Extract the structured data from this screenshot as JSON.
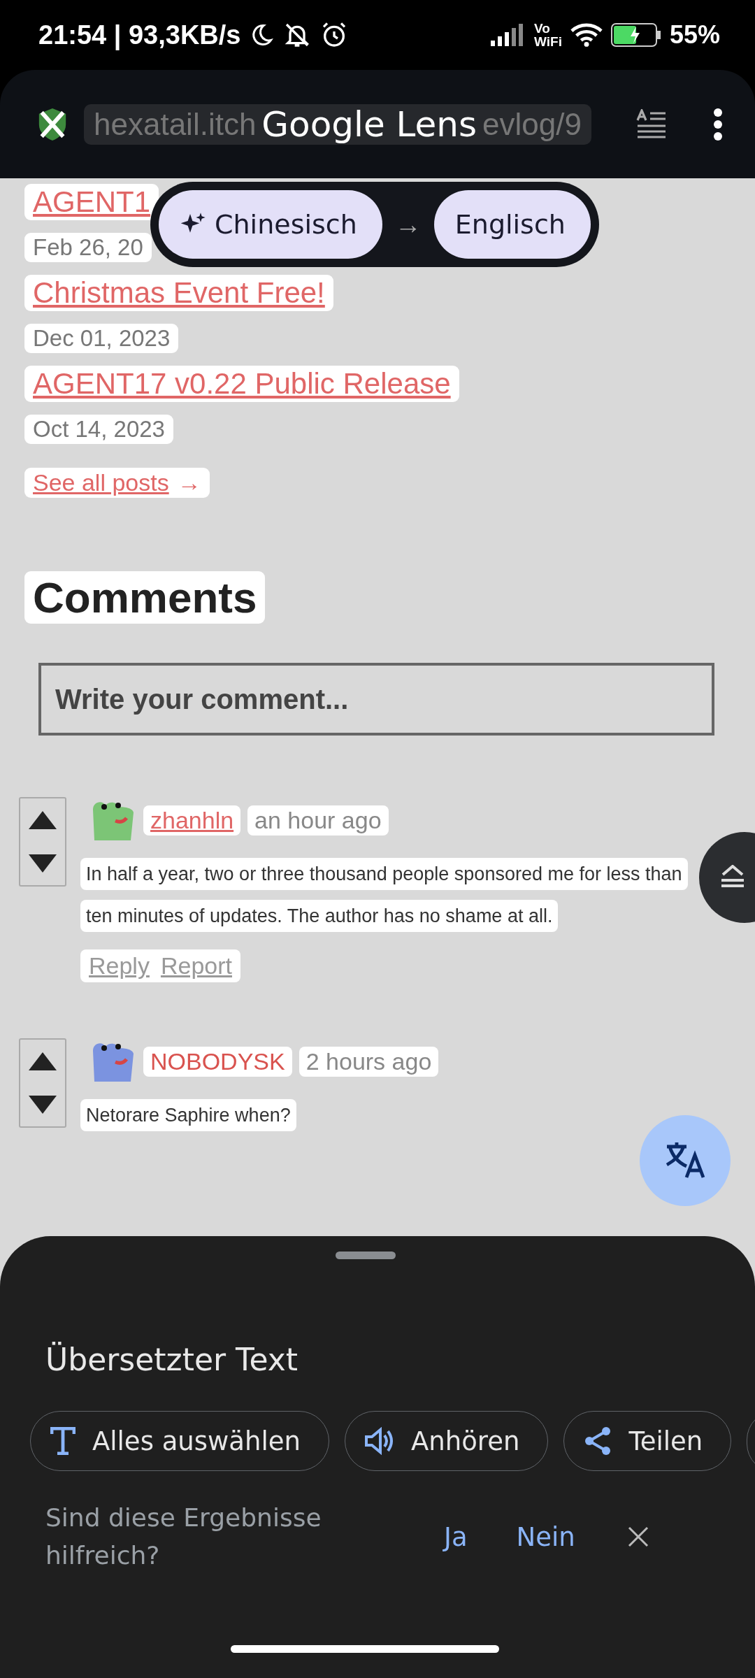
{
  "status_bar": {
    "time": "21:54 | 93,3KB/s",
    "network_label": [
      "Vo",
      "WiFi"
    ],
    "battery": "55%"
  },
  "lens_bar": {
    "title": "Google Lens",
    "url_start": "hexatail.itch",
    "url_end": "evlog/9"
  },
  "language_picker": {
    "source": "Chinesisch",
    "arrow": "→",
    "target": "Englisch"
  },
  "posts": [
    {
      "title": "AGENT1",
      "date": "Feb 26, 20"
    },
    {
      "title": "Christmas Event Free!",
      "date": "Dec 01, 2023"
    },
    {
      "title": "AGENT17 v0.22 Public Release",
      "date": "Oct 14, 2023"
    }
  ],
  "see_all": {
    "label": "See all posts",
    "arrow": "→"
  },
  "comments_heading": "Comments",
  "comment_box": {
    "placeholder": "Write your comment..."
  },
  "comments": [
    {
      "user": "zhanhln",
      "linked": true,
      "color": "#7cc576",
      "time": "an hour ago",
      "text": "In half a year, two or three thousand people sponsored me for less than ten minutes of updates. The author has no shame at all.",
      "actions": [
        "Reply",
        "Report"
      ]
    },
    {
      "user": "NOBODYSK",
      "linked": false,
      "color": "#7b93e0",
      "time": "2 hours ago",
      "text": "Netorare Saphire when?"
    }
  ],
  "sheet": {
    "title": "Übersetzter Text",
    "actions": [
      {
        "kind": "select",
        "label": "Alles auswählen"
      },
      {
        "kind": "listen",
        "label": "Anhören"
      },
      {
        "kind": "share",
        "label": "Teilen"
      }
    ],
    "feedback": {
      "question": "Sind diese Ergebnisse hilfreich?",
      "yes": "Ja",
      "no": "Nein"
    }
  }
}
